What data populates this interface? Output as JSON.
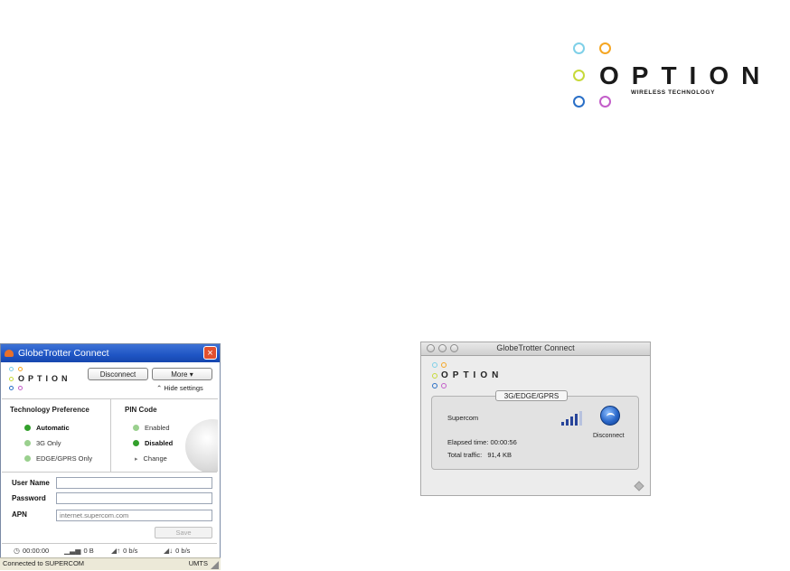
{
  "brand_logo": {
    "name": "OPTION",
    "tagline": "WIRELESS TECHNOLOGY",
    "ring_colors": [
      "#7fd0e8",
      "#f5a623",
      "#c7d93a",
      "#2a6fc7",
      "#c35ec9"
    ]
  },
  "windows_app": {
    "title": "GlobeTrotter Connect",
    "logo_text": "OPTION",
    "close_icon": "×",
    "disconnect_label": "Disconnect",
    "more_label": "More ▾",
    "hide_settings_label": "Hide settings",
    "tech_pref": {
      "title": "Technology Preference",
      "options": [
        {
          "label": "Automatic",
          "selected": true
        },
        {
          "label": "3G Only",
          "selected": false
        },
        {
          "label": "EDGE/GPRS Only",
          "selected": false
        }
      ]
    },
    "pin": {
      "title": "PIN Code",
      "options": [
        {
          "label": "Enabled",
          "selected": false
        },
        {
          "label": "Disabled",
          "selected": true
        }
      ],
      "change_label": "Change"
    },
    "form": {
      "username_label": "User Name",
      "username_value": "",
      "password_label": "Password",
      "password_value": "",
      "apn_label": "APN",
      "apn_placeholder": "internet.supercom.com",
      "save_label": "Save"
    },
    "stats": {
      "time": "00:00:00",
      "data": "0 B",
      "upload_rate": "0 b/s",
      "download_rate": "0 b/s"
    },
    "status": {
      "text": "Connected to SUPERCOM",
      "network": "UMTS"
    },
    "accent": "#1f55c4"
  },
  "mac_app": {
    "title": "GlobeTrotter Connect",
    "logo_text": "OPTION",
    "network_mode": "3G/EDGE/GPRS",
    "operator": "Supercom",
    "elapsed_label": "Elapsed time:",
    "elapsed_value": "00:00:56",
    "traffic_label": "Total traffic:",
    "traffic_value": "91,4 KB",
    "disconnect_label": "Disconnect",
    "signal_bars": 5
  }
}
